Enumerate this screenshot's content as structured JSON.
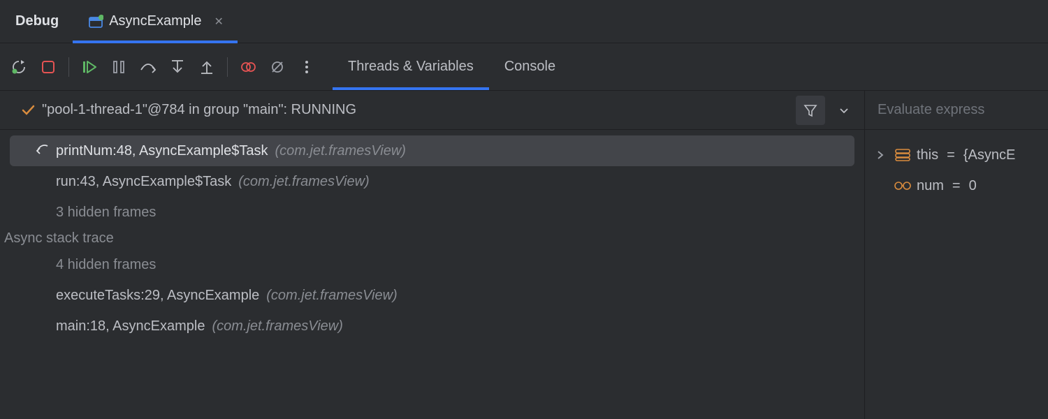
{
  "header": {
    "debug_title": "Debug",
    "run_tab_label": "AsyncExample"
  },
  "inner_tabs": {
    "threads": "Threads & Variables",
    "console": "Console"
  },
  "thread_bar": {
    "label": "\"pool-1-thread-1\"@784 in group \"main\": RUNNING"
  },
  "frames": {
    "f0_main": "printNum:48, AsyncExample$Task",
    "f0_pkg": "(com.jet.framesView)",
    "f1_main": "run:43, AsyncExample$Task",
    "f1_pkg": "(com.jet.framesView)",
    "hidden1": "3 hidden frames",
    "async_label": "Async stack trace",
    "hidden2": "4 hidden frames",
    "f2_main": "executeTasks:29, AsyncExample",
    "f2_pkg": "(com.jet.framesView)",
    "f3_main": "main:18, AsyncExample",
    "f3_pkg": "(com.jet.framesView)"
  },
  "eval": {
    "placeholder": "Evaluate express"
  },
  "vars": {
    "v0_name": "this",
    "v0_val": "{AsyncE",
    "v1_name": "num",
    "v1_val": "0"
  },
  "colors": {
    "accent": "#3574f0",
    "stop": "#e55353",
    "resume": "#5fb865",
    "orange": "#d98c3e"
  }
}
